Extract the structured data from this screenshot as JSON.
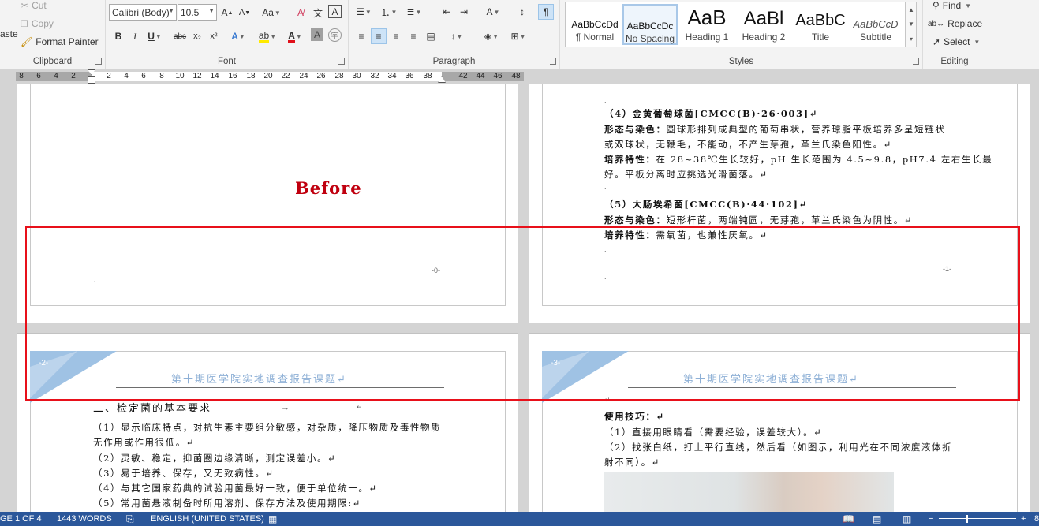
{
  "ribbon": {
    "clipboard": {
      "paste_label": "aste",
      "cut_label": "Cut",
      "copy_label": "Copy",
      "format_painter_label": "Format Painter",
      "group_label": "Clipboard"
    },
    "font": {
      "font_name": "Calibri (Body)",
      "font_size": "10.5",
      "change_case_label": "Aa",
      "bold_label": "B",
      "italic_label": "I",
      "underline_label": "U",
      "strikethrough_label": "abc",
      "subscript_label": "x₂",
      "superscript_label": "x²",
      "text_effects_label": "A",
      "font_color_label": "A",
      "char_shading_label": "A",
      "enclose_label": "字",
      "group_label": "Font"
    },
    "paragraph": {
      "group_label": "Paragraph"
    },
    "styles": {
      "items": [
        {
          "preview": "AaBbCcDd",
          "name": "¶ Normal"
        },
        {
          "preview": "AaBbCcDc",
          "name": "No Spacing"
        },
        {
          "preview": "AaB",
          "name": "Heading 1"
        },
        {
          "preview": "AaBl",
          "name": "Heading 2"
        },
        {
          "preview": "AaBbC",
          "name": "Title"
        },
        {
          "preview": "AaBbCcD",
          "name": "Subtitle"
        }
      ],
      "group_label": "Styles"
    },
    "editing": {
      "find_label": "Find",
      "replace_label": "Replace",
      "select_label": "Select",
      "group_label": "Editing"
    }
  },
  "ruler": {
    "ticks": [
      "8",
      "6",
      "4",
      "2",
      "2",
      "4",
      "6",
      "8",
      "10",
      "12",
      "14",
      "16",
      "18",
      "20",
      "22",
      "24",
      "26",
      "28",
      "30",
      "32",
      "34",
      "36",
      "38",
      "42",
      "44",
      "46",
      "48"
    ]
  },
  "pages": {
    "p1": {
      "annotation": "Before",
      "footer_number": "-0-",
      "para_mark": "."
    },
    "p2": {
      "lines": [
        {
          "text": "（4）金黄葡萄球菌[CMCC(B)·26·003]↵",
          "bold": true
        },
        {
          "bold_part": "形态与染色：",
          "text": "圆球形排列成典型的葡萄串状，营养琼脂平板培养多呈短链状"
        },
        {
          "text": "或双球状，无鞭毛，不能动，不产生芽孢，革兰氏染色阳性。↵"
        },
        {
          "bold_part": "培养特性：",
          "text": "在 28~38℃生长较好，pH 生长范围为 4.5~9.8，pH7.4 左右生长最"
        },
        {
          "text": "好。平板分离时应挑选光滑菌落。↵"
        },
        {
          "text": "（5）大肠埃希菌[CMCC(B)·44·102]↵",
          "bold": true
        },
        {
          "bold_part": "形态与染色：",
          "text": "短形杆菌，两端钝圆，无芽孢，革兰氏染色为阴性。↵"
        },
        {
          "bold_part": "培养特性：",
          "text": "需氧菌，也兼性厌氧。↵"
        }
      ],
      "footer_number": "-1-"
    },
    "p3": {
      "header_number": "-2-",
      "header_title": "第十期医学院实地调查报告课题↵",
      "section_title": "二、检定菌的基本要求",
      "lines": [
        "（1）显示临床特点，对抗生素主要组分敏感，对杂质，降压物质及毒性物质",
        "无作用或作用很低。↵",
        "（2）灵敏、稳定，抑菌圈边缘清晰，测定误差小。↵",
        "（3）易于培养、保存，又无致病性。↵",
        "（4）与其它国家药典的试验用菌最好一致，便于单位统一。↵",
        "（5）常用菌悬液制备时所用溶剂、保存方法及使用期限:↵"
      ]
    },
    "p4": {
      "header_number": "-3-",
      "header_title": "第十期医学院实地调查报告课题↵",
      "lines": [
        {
          "text": "使用技巧：↵",
          "bold": true
        },
        {
          "text": "（1）直接用眼睛看（需要经验，误差较大）。↵"
        },
        {
          "text": "（2）找张白纸，打上平行直线，然后看（如图示，利用光在不同浓度液体折"
        },
        {
          "text": "射不同）。↵"
        }
      ]
    }
  },
  "status": {
    "page": "GE 1 OF 4",
    "words": "1443 WORDS",
    "language": "ENGLISH (UNITED STATES)",
    "zoom": "8"
  },
  "colors": {
    "status_bg": "#2b579a",
    "annotation": "#c0000f",
    "highlight_box": "#e8101a",
    "header_blue": "#8eb0d6"
  }
}
